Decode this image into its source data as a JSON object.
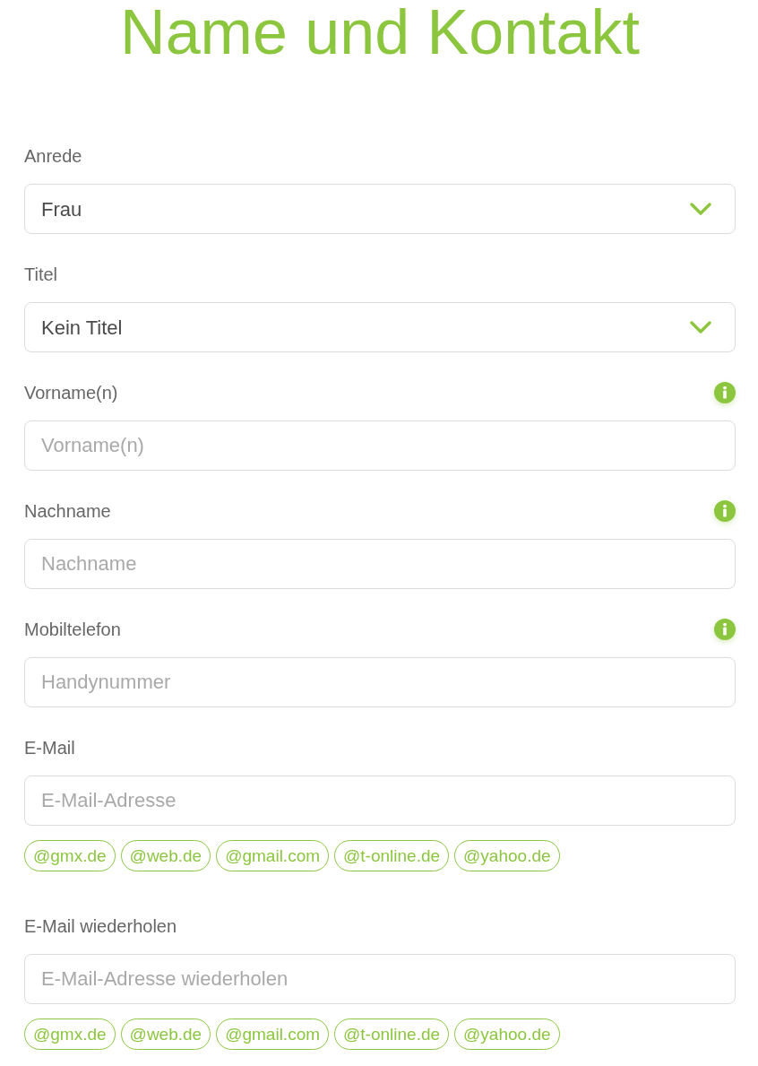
{
  "title": "Name und Kontakt",
  "fields": [
    {
      "kind": "select",
      "label": "Anrede",
      "value": "Frau"
    },
    {
      "kind": "select",
      "label": "Titel",
      "value": "Kein Titel"
    },
    {
      "kind": "text",
      "label": "Vorname(n)",
      "placeholder": "Vorname(n)",
      "info": true
    },
    {
      "kind": "text",
      "label": "Nachname",
      "placeholder": "Nachname",
      "info": true
    },
    {
      "kind": "text",
      "label": "Mobiltelefon",
      "placeholder": "Handynummer",
      "info": true
    },
    {
      "kind": "text",
      "label": "E-Mail",
      "placeholder": "E-Mail-Adresse",
      "suggestions": [
        "@gmx.de",
        "@web.de",
        "@gmail.com",
        "@t-online.de",
        "@yahoo.de"
      ]
    },
    {
      "kind": "text",
      "label": "E-Mail wiederholen",
      "placeholder": "E-Mail-Adresse wiederholen",
      "suggestions": [
        "@gmx.de",
        "@web.de",
        "@gmail.com",
        "@t-online.de",
        "@yahoo.de"
      ]
    }
  ]
}
